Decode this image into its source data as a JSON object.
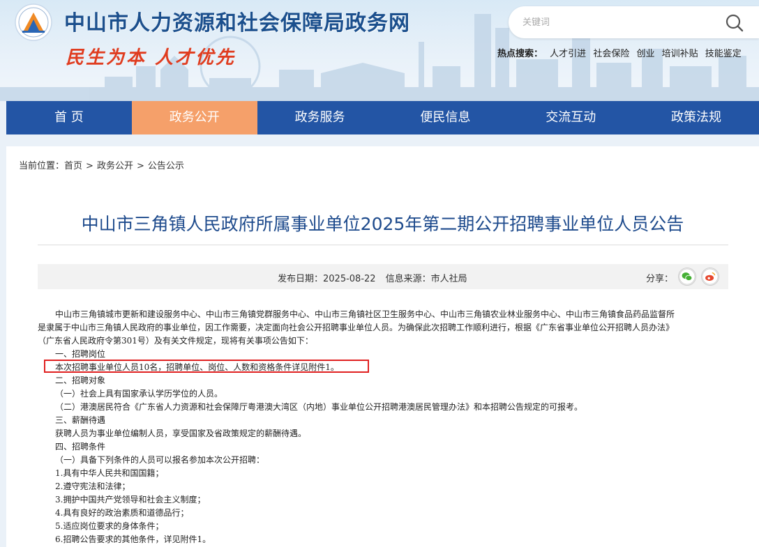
{
  "header": {
    "site_title": "中山市人力资源和社会保障局政务网",
    "slogan": "民生为本 人才优先",
    "search_placeholder": "关键词",
    "hot_label": "热点搜索：",
    "hot_links": [
      "人才引进",
      "社会保险",
      "创业",
      "培训补贴",
      "技能鉴定"
    ]
  },
  "nav": {
    "items": [
      {
        "label": "首 页"
      },
      {
        "label": "政务公开"
      },
      {
        "label": "政务服务"
      },
      {
        "label": "便民信息"
      },
      {
        "label": "交流互动"
      },
      {
        "label": "政策法规"
      }
    ],
    "active_color": "#f5a06a",
    "bar_color": "#2355a5"
  },
  "breadcrumb": {
    "prefix": "当前位置：",
    "items": [
      "首页",
      "政务公开",
      "公告公示"
    ],
    "separator": ">"
  },
  "article": {
    "title": "中山市三角镇人民政府所属事业单位2025年第二期公开招聘事业单位人员公告",
    "publish_label": "发布日期：",
    "publish_date": "2025-08-22",
    "source_label": "信息来源：",
    "source": "市人社局",
    "share_label": "分享：",
    "paragraphs": [
      "中山市三角镇城市更新和建设服务中心、中山市三角镇党群服务中心、中山市三角镇社区卫生服务中心、中山市三角镇农业林业服务中心、中山市三角镇食品药品监督所",
      "是隶属于中山市三角镇人民政府的事业单位，因工作需要，决定面向社会公开招聘事业单位人员。为确保此次招聘工作顺利进行，根据《广东省事业单位公开招聘人员办法》",
      "（广东省人民政府令第301号）及有关文件规定，现将有关事项公告如下：",
      "一、招聘岗位",
      "本次招聘事业单位人员10名，招聘单位、岗位、人数和资格条件详见附件1。",
      "二、招聘对象",
      "（一）社会上具有国家承认学历学位的人员。",
      "（二）港澳居民符合《广东省人力资源和社会保障厅粤港澳大湾区（内地）事业单位公开招聘港澳居民管理办法》和本招聘公告规定的可报考。",
      "三、薪酬待遇",
      "获聘人员为事业单位编制人员，享受国家及省政策规定的薪酬待遇。",
      "四、招聘条件",
      "（一）具备下列条件的人员可以报名参加本次公开招聘：",
      "1.具有中华人民共和国国籍；",
      "2.遵守宪法和法律；",
      "3.拥护中国共产党领导和社会主义制度；",
      "4.具有良好的政治素质和道德品行；",
      "5.适应岗位要求的身体条件；",
      "6.招聘公告要求的其他条件，详见附件1。"
    ]
  }
}
